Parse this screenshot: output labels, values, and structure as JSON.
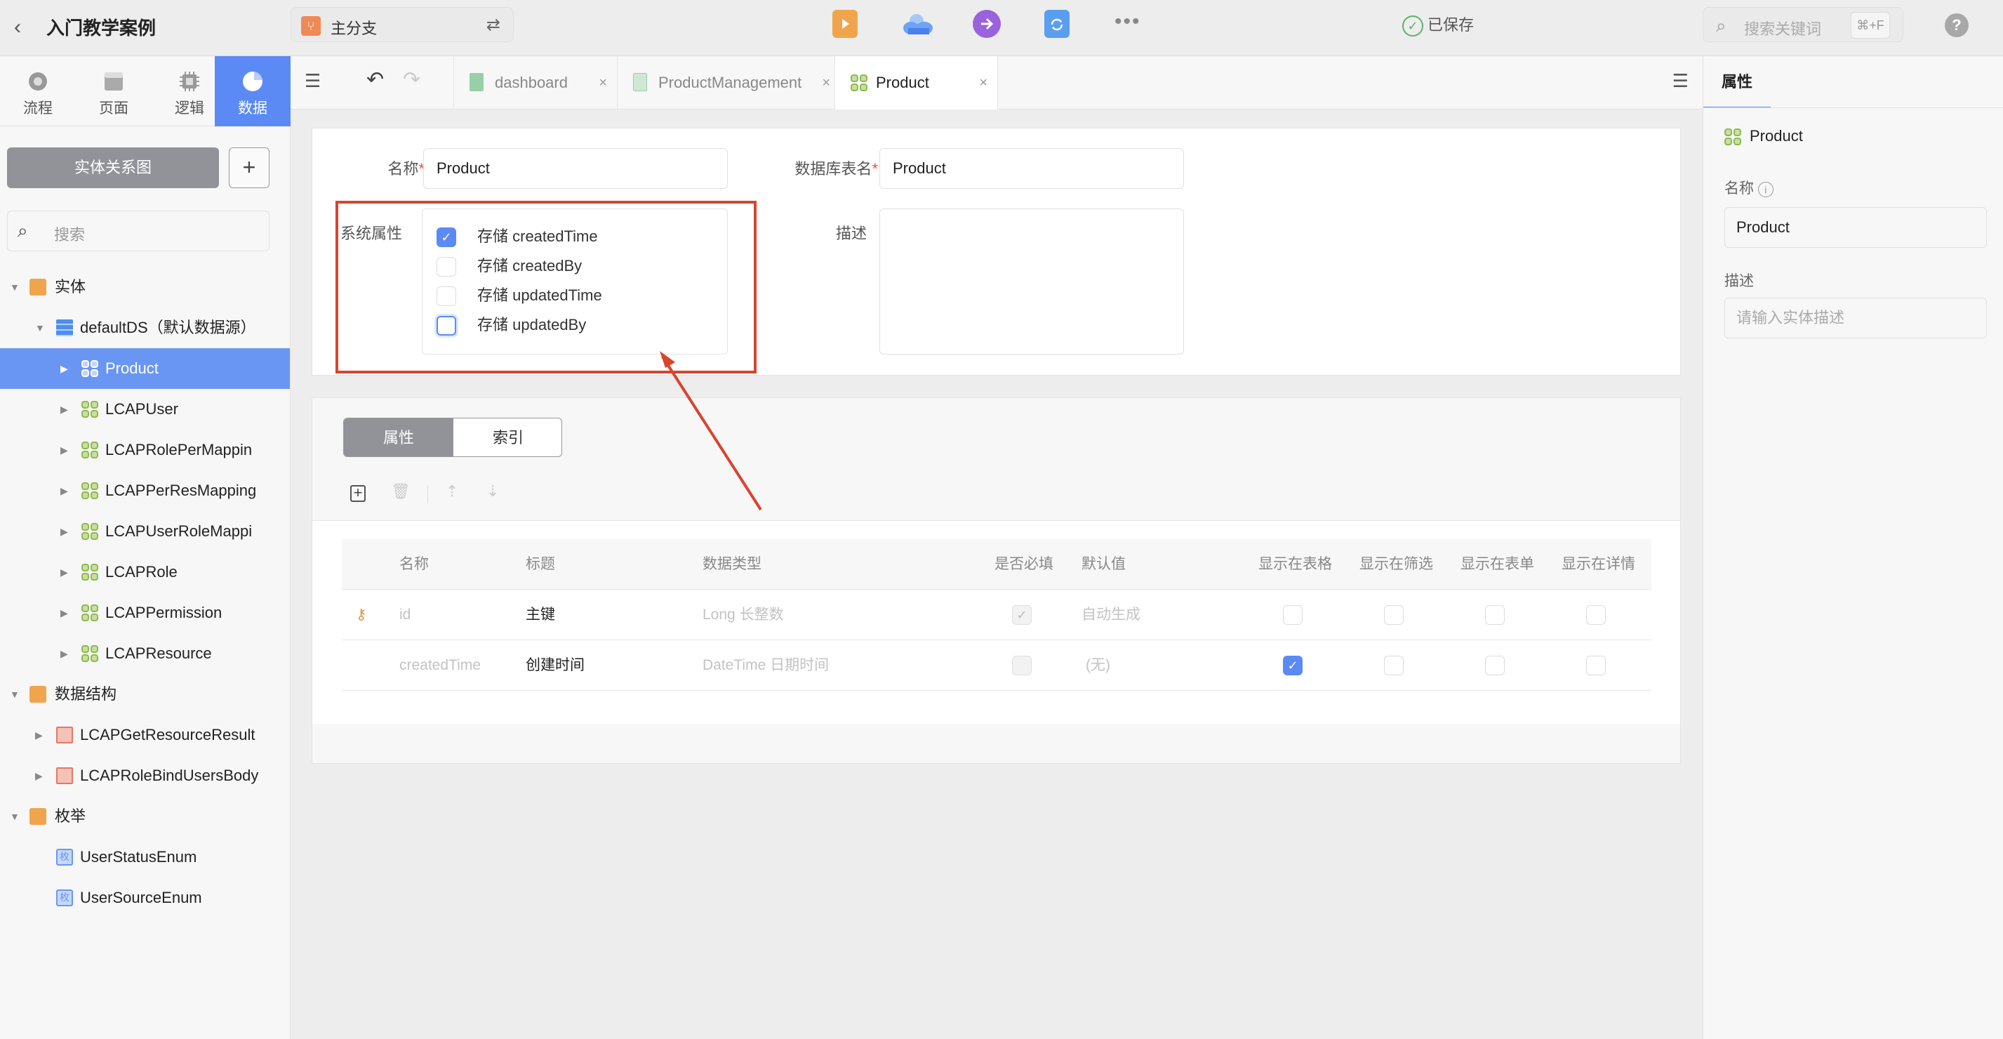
{
  "topbar": {
    "back_icon": "chevron-left-icon",
    "app_title": "入门教学案例",
    "branch": {
      "icon": "branch-icon",
      "label": "主分支",
      "switch_icon": "swap-icon"
    },
    "tools": [
      {
        "name": "preview-icon",
        "color": "#f0a54d"
      },
      {
        "name": "cloud-deploy-icon",
        "color": "#4d8ff0"
      },
      {
        "name": "publish-arrow-icon",
        "color": "#9a62dc"
      },
      {
        "name": "sync-icon",
        "color": "#4d8ff0"
      },
      {
        "name": "more-icon",
        "color": "#888888"
      }
    ],
    "saved_status": "已保存",
    "search_placeholder": "搜索关键词",
    "search_shortcut": "⌘+F",
    "help": "?"
  },
  "sidebar": {
    "activity_tabs": [
      {
        "label": "流程",
        "icon": "flow-icon",
        "active": false
      },
      {
        "label": "页面",
        "icon": "page-icon",
        "active": false
      },
      {
        "label": "逻辑",
        "icon": "logic-chip-icon",
        "active": true
      },
      {
        "label": "数据",
        "icon": "data-pie-icon",
        "active": true
      }
    ],
    "er_button": "实体关系图",
    "add_button": "+",
    "search_placeholder": "搜索",
    "tree": [
      {
        "label": "实体",
        "type": "folder",
        "level": 0,
        "expanded": true
      },
      {
        "label": "defaultDS（默认数据源）",
        "type": "datasource",
        "level": 1,
        "expanded": true
      },
      {
        "label": "Product",
        "type": "entity",
        "level": 2,
        "selected": true
      },
      {
        "label": "LCAPUser",
        "type": "entity",
        "level": 2
      },
      {
        "label": "LCAPRolePerMappin",
        "type": "entity",
        "level": 2
      },
      {
        "label": "LCAPPerResMapping",
        "type": "entity",
        "level": 2
      },
      {
        "label": "LCAPUserRoleMappi",
        "type": "entity",
        "level": 2
      },
      {
        "label": "LCAPRole",
        "type": "entity",
        "level": 2
      },
      {
        "label": "LCAPPermission",
        "type": "entity",
        "level": 2
      },
      {
        "label": "LCAPResource",
        "type": "entity",
        "level": 2
      },
      {
        "label": "数据结构",
        "type": "folder",
        "level": 0,
        "expanded": true
      },
      {
        "label": "LCAPGetResourceResult",
        "type": "structure",
        "level": 1
      },
      {
        "label": "LCAPRoleBindUsersBody",
        "type": "structure",
        "level": 1
      },
      {
        "label": "枚举",
        "type": "folder",
        "level": 0,
        "expanded": true
      },
      {
        "label": "UserStatusEnum",
        "type": "enum",
        "level": 1
      },
      {
        "label": "UserSourceEnum",
        "type": "enum",
        "level": 1
      }
    ],
    "enum_badge": "枚"
  },
  "tabs": [
    {
      "label": "dashboard",
      "icon": "page-file-icon",
      "active": false
    },
    {
      "label": "ProductManagement",
      "icon": "page-file-icon",
      "active": false
    },
    {
      "label": "Product",
      "icon": "entity-icon",
      "active": true
    }
  ],
  "tab_close": "×",
  "form": {
    "name_label": "名称",
    "name_value": "Product",
    "table_label": "数据库表名",
    "table_value": "Product",
    "required_mark": "*",
    "sys_label": "系统属性",
    "sys_options": [
      {
        "label": "存储 createdTime",
        "checked": true
      },
      {
        "label": "存储 createdBy",
        "checked": false
      },
      {
        "label": "存储 updatedTime",
        "checked": false
      },
      {
        "label": "存储 updatedBy",
        "checked": false,
        "focused": true
      }
    ],
    "desc_label": "描述",
    "desc_value": ""
  },
  "props": {
    "segments": [
      "属性",
      "索引"
    ],
    "toolbar": [
      "add-icon",
      "delete-icon",
      "move-up-icon",
      "move-down-icon"
    ],
    "columns": [
      "名称",
      "标题",
      "数据类型",
      "是否必填",
      "默认值",
      "显示在表格",
      "显示在筛选",
      "显示在表单",
      "显示在详情"
    ],
    "rows": [
      {
        "key": true,
        "name": "id",
        "title": "主键",
        "type": "Long 长整数",
        "required": true,
        "required_disabled": true,
        "default": "自动生成",
        "show_table": false,
        "show_filter": false,
        "show_form": false,
        "show_detail": false
      },
      {
        "key": false,
        "name": "createdTime",
        "title": "创建时间",
        "type": "DateTime 日期时间",
        "required": false,
        "required_disabled": true,
        "default": "(无)",
        "show_table": true,
        "show_filter": false,
        "show_form": false,
        "show_detail": false
      }
    ]
  },
  "right_panel": {
    "tab": "属性",
    "entity_name": "Product",
    "name_label": "名称",
    "name_value": "Product",
    "desc_label": "描述",
    "desc_placeholder": "请输入实体描述"
  },
  "check_mark": "✓"
}
